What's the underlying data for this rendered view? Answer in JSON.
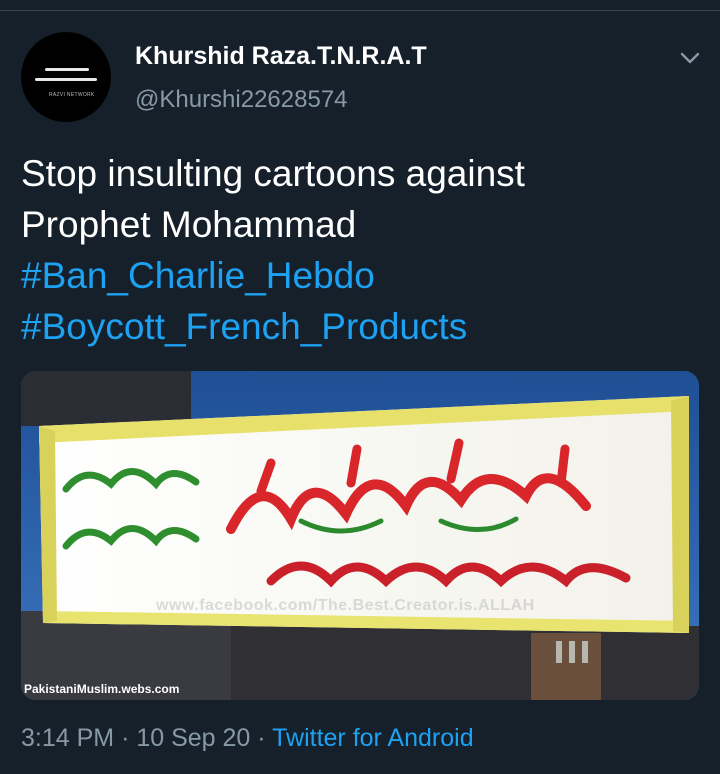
{
  "tweet": {
    "author_name": "Khurshid Raza.T.N.R.A.T",
    "author_handle": "@Khurshi22628574",
    "text_lines": [
      "Stop insulting cartoons against",
      "Prophet Mohammad"
    ],
    "hashtags": [
      "#Ban_Charlie_Hebdo",
      "#Boycott_French_Products"
    ],
    "time": "3:14 PM",
    "separator": "·",
    "date": "10 Sep 20",
    "client": "Twitter for Android"
  },
  "avatar": {
    "caption": "RAZVI NETWORK"
  },
  "media": {
    "watermark_fb": "www.facebook.com/The.Best.Creator.is.ALLAH",
    "watermark_site": "PakistaniMuslim.webs.com"
  },
  "icons": {
    "menu": "chevron-down-icon"
  },
  "colors": {
    "background": "#15202b",
    "link": "#1da1f2",
    "secondary": "#8899a6"
  }
}
